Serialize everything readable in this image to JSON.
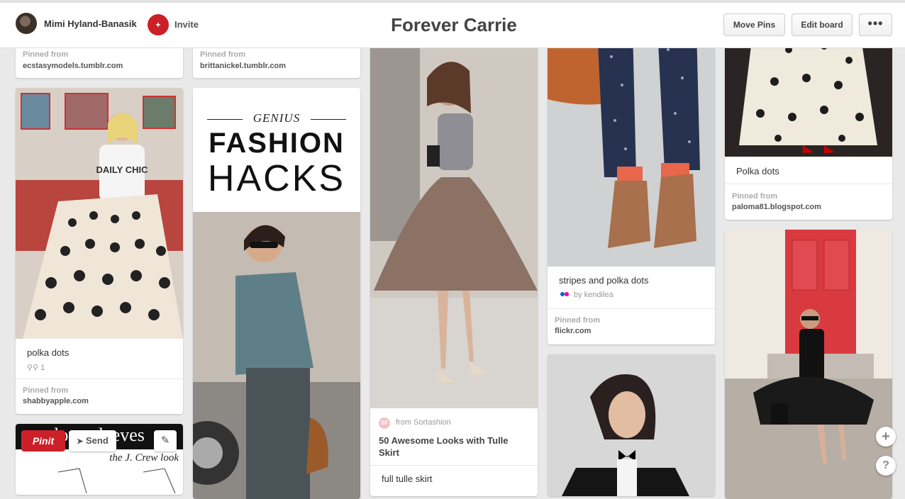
{
  "header": {
    "user_name": "Mimi Hyland-Banasik",
    "invite_label": "Invite",
    "invite_icon_text": "+",
    "board_title": "Forever Carrie",
    "move_pins_label": "Move Pins",
    "edit_board_label": "Edit board",
    "more_label": "•••"
  },
  "pins": {
    "col1_top": {
      "pinned_label": "Pinned from",
      "source": "ecstasymodels.tumblr.com"
    },
    "col1_polka": {
      "image_text": "DAILY CHIC",
      "description": "polka dots",
      "repins": "1",
      "pinned_label": "Pinned from",
      "source": "shabbyapple.com"
    },
    "col1_bottom": {
      "image_text": "long sleeves",
      "image_subtext": "the J. Crew look"
    },
    "col2_top": {
      "pinned_label": "Pinned from",
      "source": "brittanickel.tumblr.com"
    },
    "col2_hacks": {
      "line1": "GENIUS",
      "line2": "FASHION",
      "line3": "HACKS"
    },
    "col3_tulle": {
      "from_badge": "SF",
      "from_label": "from Sortashion",
      "title": "50 Awesome Looks with Tulle Skirt",
      "description": "full tulle skirt"
    },
    "col4_stripes": {
      "description": "stripes and polka dots",
      "by_label": "by kendilea",
      "pinned_label": "Pinned from",
      "source": "flickr.com"
    },
    "col5_polka": {
      "description": "Polka dots",
      "pinned_label": "Pinned from",
      "source": "paloma81.blogspot.com"
    }
  },
  "hover_actions": {
    "pinit_label": "Pinit",
    "send_label": "Send",
    "edit_icon": "✎"
  },
  "side_buttons": {
    "add_label": "+",
    "help_label": "?"
  },
  "colors": {
    "brand_red": "#cb2027"
  }
}
